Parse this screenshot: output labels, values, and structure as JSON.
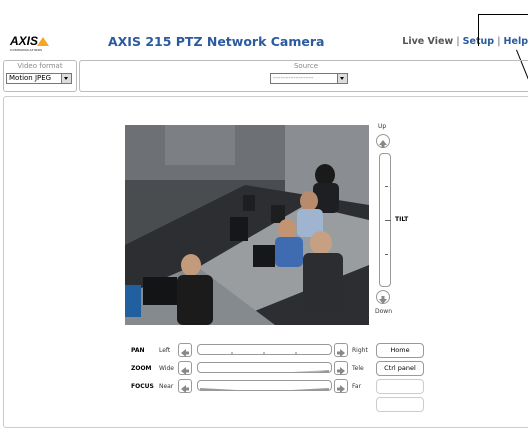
{
  "header": {
    "logo_text": "AXIS",
    "logo_subtext": "COMMUNICATIONS",
    "title": "AXIS 215 PTZ Network Camera",
    "nav": [
      {
        "label": "Live View",
        "link": false
      },
      {
        "label": "Setup",
        "link": true
      },
      {
        "label": "Help",
        "link": true
      }
    ]
  },
  "video_format": {
    "label": "Video format",
    "selected": "Motion JPEG"
  },
  "source": {
    "label": "Source",
    "selected": "----------------"
  },
  "ptz": {
    "tilt": {
      "up_label": "Up",
      "name": "TILT",
      "down_label": "Down"
    },
    "pan": {
      "name": "PAN",
      "left_label": "Left",
      "right_label": "Right"
    },
    "zoom": {
      "name": "ZOOM",
      "left_label": "Wide",
      "right_label": "Tele"
    },
    "focus": {
      "name": "FOCUS",
      "left_label": "Near",
      "right_label": "Far"
    }
  },
  "buttons": {
    "home": "Home",
    "ctrl_panel": "Ctrl panel"
  },
  "colors": {
    "title_blue": "#2a5a9f",
    "logo_accent": "#f5a623"
  }
}
